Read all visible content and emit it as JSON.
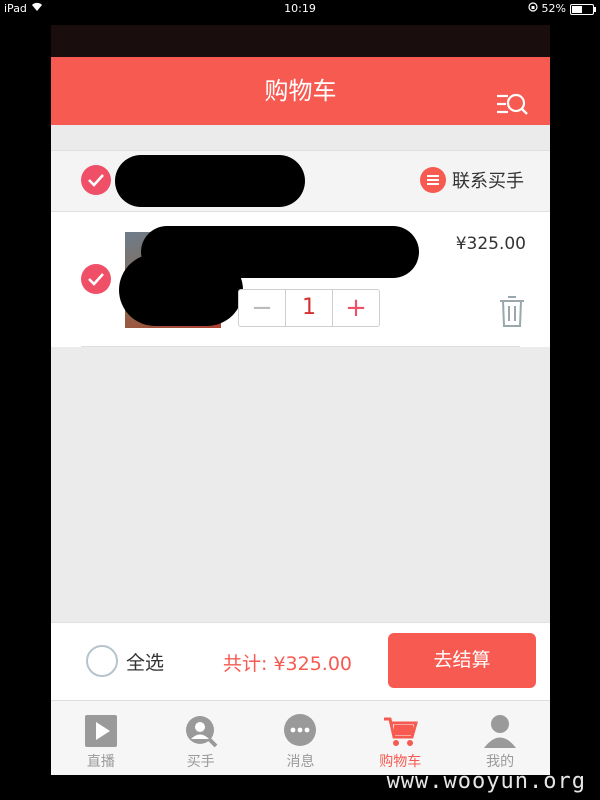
{
  "status_bar": {
    "device": "iPad",
    "time": "10:19",
    "battery": "52%"
  },
  "navbar": {
    "title": "购物车"
  },
  "shop": {
    "contact_label": "联系买手"
  },
  "item": {
    "price": "¥325.00",
    "quantity": "1",
    "minus": "−",
    "plus": "+"
  },
  "footer": {
    "select_all": "全选",
    "total": "共计: ¥325.00",
    "checkout": "去结算"
  },
  "tabs": [
    {
      "label": "直播",
      "icon": "play-icon"
    },
    {
      "label": "买手",
      "icon": "buyer-search-icon"
    },
    {
      "label": "消息",
      "icon": "message-icon"
    },
    {
      "label": "购物车",
      "icon": "cart-icon",
      "active": true
    },
    {
      "label": "我的",
      "icon": "profile-icon"
    }
  ],
  "watermark": "www.wooyun.org",
  "colors": {
    "accent": "#f75a51",
    "check": "#ef4f67"
  }
}
